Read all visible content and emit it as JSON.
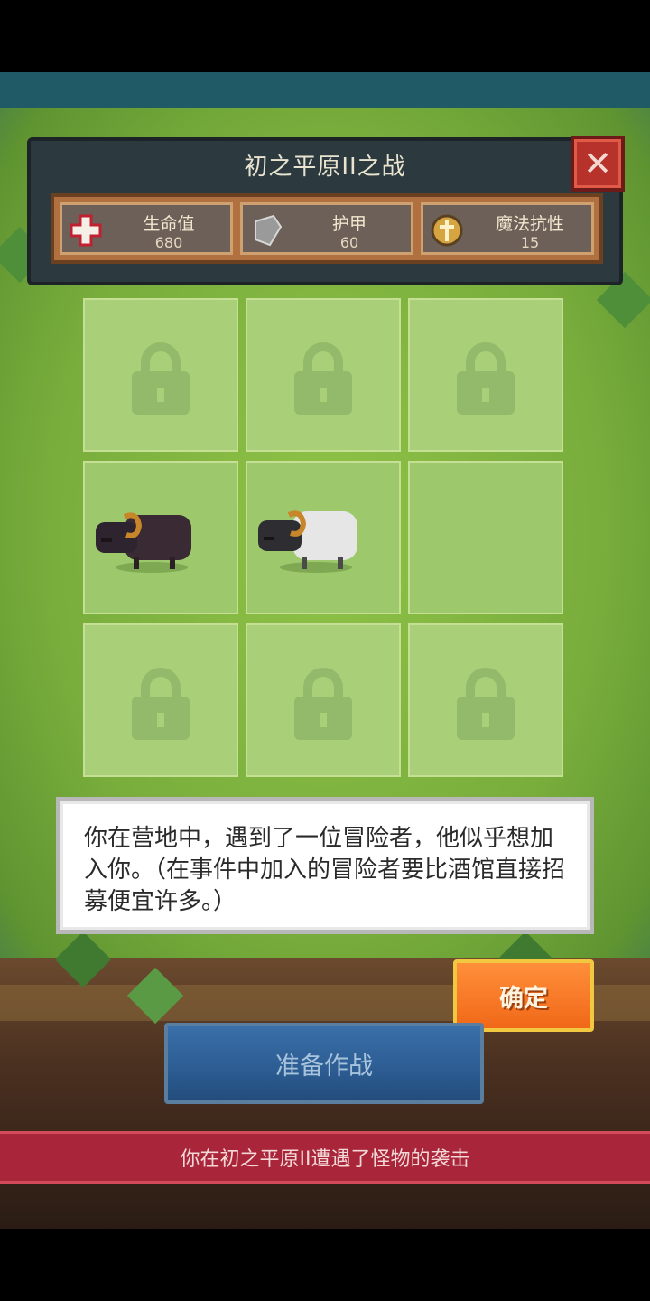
{
  "header": {
    "title": "初之平原II之战",
    "stats": [
      {
        "label": "生命值",
        "value": "680",
        "icon": "health-cross-icon"
      },
      {
        "label": "护甲",
        "value": "60",
        "icon": "armor-shield-icon"
      },
      {
        "label": "魔法抗性",
        "value": "15",
        "icon": "magic-resist-icon"
      }
    ]
  },
  "grid": {
    "rows": 3,
    "cols": 3,
    "cells": [
      {
        "state": "locked"
      },
      {
        "state": "locked"
      },
      {
        "state": "locked"
      },
      {
        "state": "unit",
        "unit": "dark-ram"
      },
      {
        "state": "unit",
        "unit": "white-ram"
      },
      {
        "state": "empty"
      },
      {
        "state": "locked"
      },
      {
        "state": "locked"
      },
      {
        "state": "locked"
      }
    ]
  },
  "dialog": {
    "message": "你在营地中，遇到了一位冒险者，他似乎想加入你。（在事件中加入的冒险者要比酒馆直接招募便宜许多。）",
    "confirm_label": "确定"
  },
  "battle_button_label": "准备作战",
  "banner_text": "你在初之平原II遭遇了怪物的袭击",
  "colors": {
    "confirm": "#f06818",
    "battle": "#2c5c92",
    "banner": "#a8253a",
    "close": "#b8322c"
  }
}
